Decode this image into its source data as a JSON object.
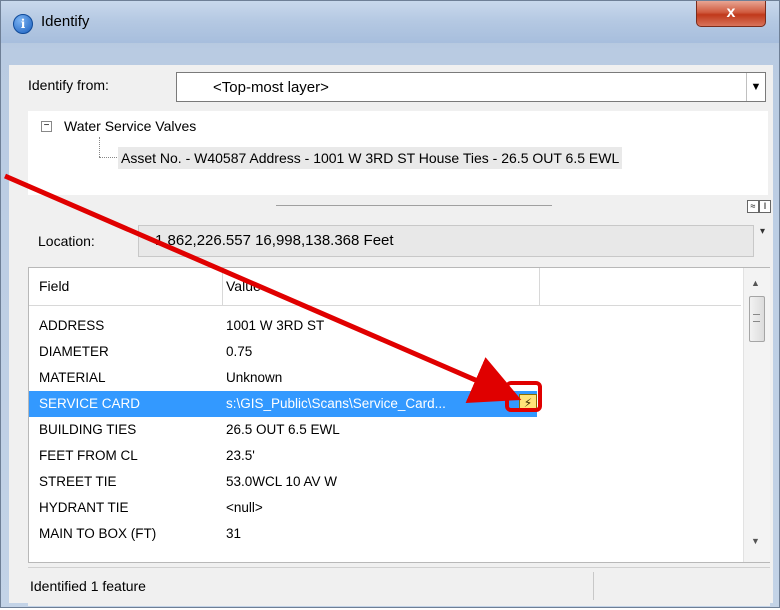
{
  "window": {
    "title": "Identify",
    "close_label": "x"
  },
  "identify_from": {
    "label": "Identify from:",
    "selected": "<Top-most layer>"
  },
  "tree": {
    "layer": "Water Service Valves",
    "feature": "Asset No. - W40587 Address - 1001 W 3RD ST House Ties - 26.5 OUT 6.5 EWL"
  },
  "location": {
    "label": "Location:",
    "value": "1,862,226.557  16,998,138.368 Feet"
  },
  "grid": {
    "headers": {
      "field": "Field",
      "value": "Value"
    },
    "rows": [
      {
        "field": "ADDRESS",
        "value": "1001 W 3RD ST"
      },
      {
        "field": "DIAMETER",
        "value": "0.75"
      },
      {
        "field": "MATERIAL",
        "value": "Unknown"
      },
      {
        "field": "SERVICE CARD",
        "value": "s:\\GIS_Public\\Scans\\Service_Card..."
      },
      {
        "field": "BUILDING TIES",
        "value": "26.5 OUT 6.5 EWL"
      },
      {
        "field": "FEET FROM CL",
        "value": "23.5'"
      },
      {
        "field": "STREET TIE",
        "value": "53.0WCL 10 AV W"
      },
      {
        "field": "HYDRANT TIE",
        "value": "<null>"
      },
      {
        "field": "MAIN TO BOX (FT)",
        "value": "31"
      }
    ],
    "selected_row": 3
  },
  "status": {
    "text": "Identified 1 feature"
  },
  "colors": {
    "selection": "#3399ff",
    "annotation": "#e00000"
  },
  "icons": [
    "info-icon",
    "close-icon",
    "collapse-icon",
    "hyperlink-lightning-icon"
  ]
}
